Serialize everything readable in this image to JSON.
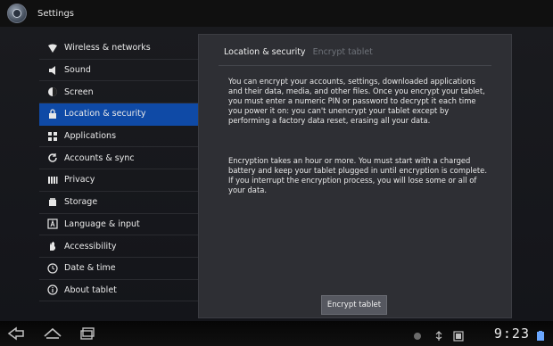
{
  "app": {
    "title": "Settings"
  },
  "sidebar": {
    "items": [
      {
        "label": "Wireless & networks",
        "icon": "wifi-icon"
      },
      {
        "label": "Sound",
        "icon": "speaker-icon"
      },
      {
        "label": "Screen",
        "icon": "brightness-icon"
      },
      {
        "label": "Location & security",
        "icon": "lock-icon",
        "active": true
      },
      {
        "label": "Applications",
        "icon": "apps-icon"
      },
      {
        "label": "Accounts & sync",
        "icon": "sync-icon"
      },
      {
        "label": "Privacy",
        "icon": "privacy-icon"
      },
      {
        "label": "Storage",
        "icon": "storage-icon"
      },
      {
        "label": "Language & input",
        "icon": "language-icon"
      },
      {
        "label": "Accessibility",
        "icon": "hand-icon"
      },
      {
        "label": "Date & time",
        "icon": "clock-icon"
      },
      {
        "label": "About tablet",
        "icon": "info-icon"
      }
    ]
  },
  "content": {
    "breadcrumb": "Location & security",
    "breadcrumb_sub": "Encrypt tablet",
    "paragraph1": "You can encrypt your accounts, settings, downloaded applications and their data, media, and other files. Once you encrypt your tablet, you must enter a numeric PIN or password to decrypt it each time you power it on: you can't unencrypt your tablet except by performing a factory data reset, erasing all your data.",
    "paragraph2": "Encryption takes an hour or more. You must start with a charged battery and keep your tablet plugged in until encryption is complete. If you interrupt the encryption process, you will lose some or all of your data.",
    "button_label": "Encrypt tablet"
  },
  "status": {
    "time": "9:23"
  },
  "colors": {
    "accent": "#0f4aa6",
    "panel": "#2e2f34"
  }
}
